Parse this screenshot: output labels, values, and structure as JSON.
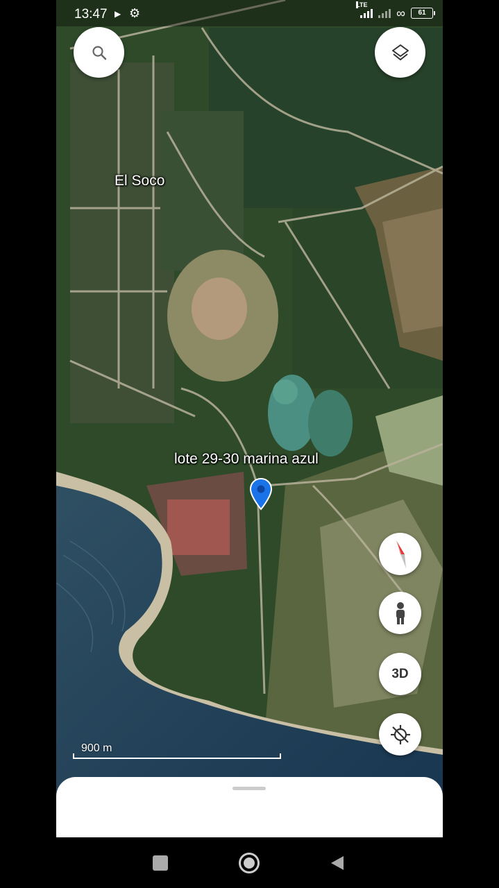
{
  "status_bar": {
    "time": "13:47",
    "network_label": "LTE",
    "battery": "61",
    "icons": [
      "play-icon",
      "gear-icon",
      "signal-icon",
      "hotspot-icon",
      "battery-icon"
    ]
  },
  "map": {
    "type": "satellite",
    "labels": {
      "area": "El Soco",
      "pin": "lote 29-30 marina azul"
    },
    "scale_label": "900 m",
    "pin_color": "#1a73e8"
  },
  "controls": {
    "search_icon": "search-icon",
    "layers_icon": "layers-icon",
    "compass_icon": "compass-icon",
    "street_view_icon": "pegman-icon",
    "three_d_label": "3D",
    "location_icon": "location-off-icon"
  },
  "nav_bar": {
    "icons": [
      "recents-icon",
      "home-icon",
      "back-icon"
    ]
  }
}
